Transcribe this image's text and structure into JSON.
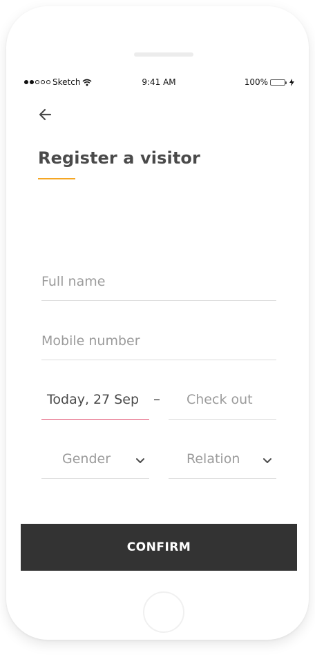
{
  "status_bar": {
    "carrier": "Sketch",
    "time": "9:41 AM",
    "battery": "100%"
  },
  "header": {
    "back_icon": "arrow-left-icon",
    "title": "Register a visitor",
    "accent_color": "#f5a623"
  },
  "form": {
    "full_name_placeholder": "Full name",
    "mobile_placeholder": "Mobile number",
    "checkin_value": "Today, 27 Sep",
    "separator": "–",
    "checkout_placeholder": "Check out",
    "gender_placeholder": "Gender",
    "relation_placeholder": "Relation",
    "active_underline_color": "#e35d7a"
  },
  "footer": {
    "confirm_label": "CONFIRM",
    "button_color": "#333333"
  }
}
